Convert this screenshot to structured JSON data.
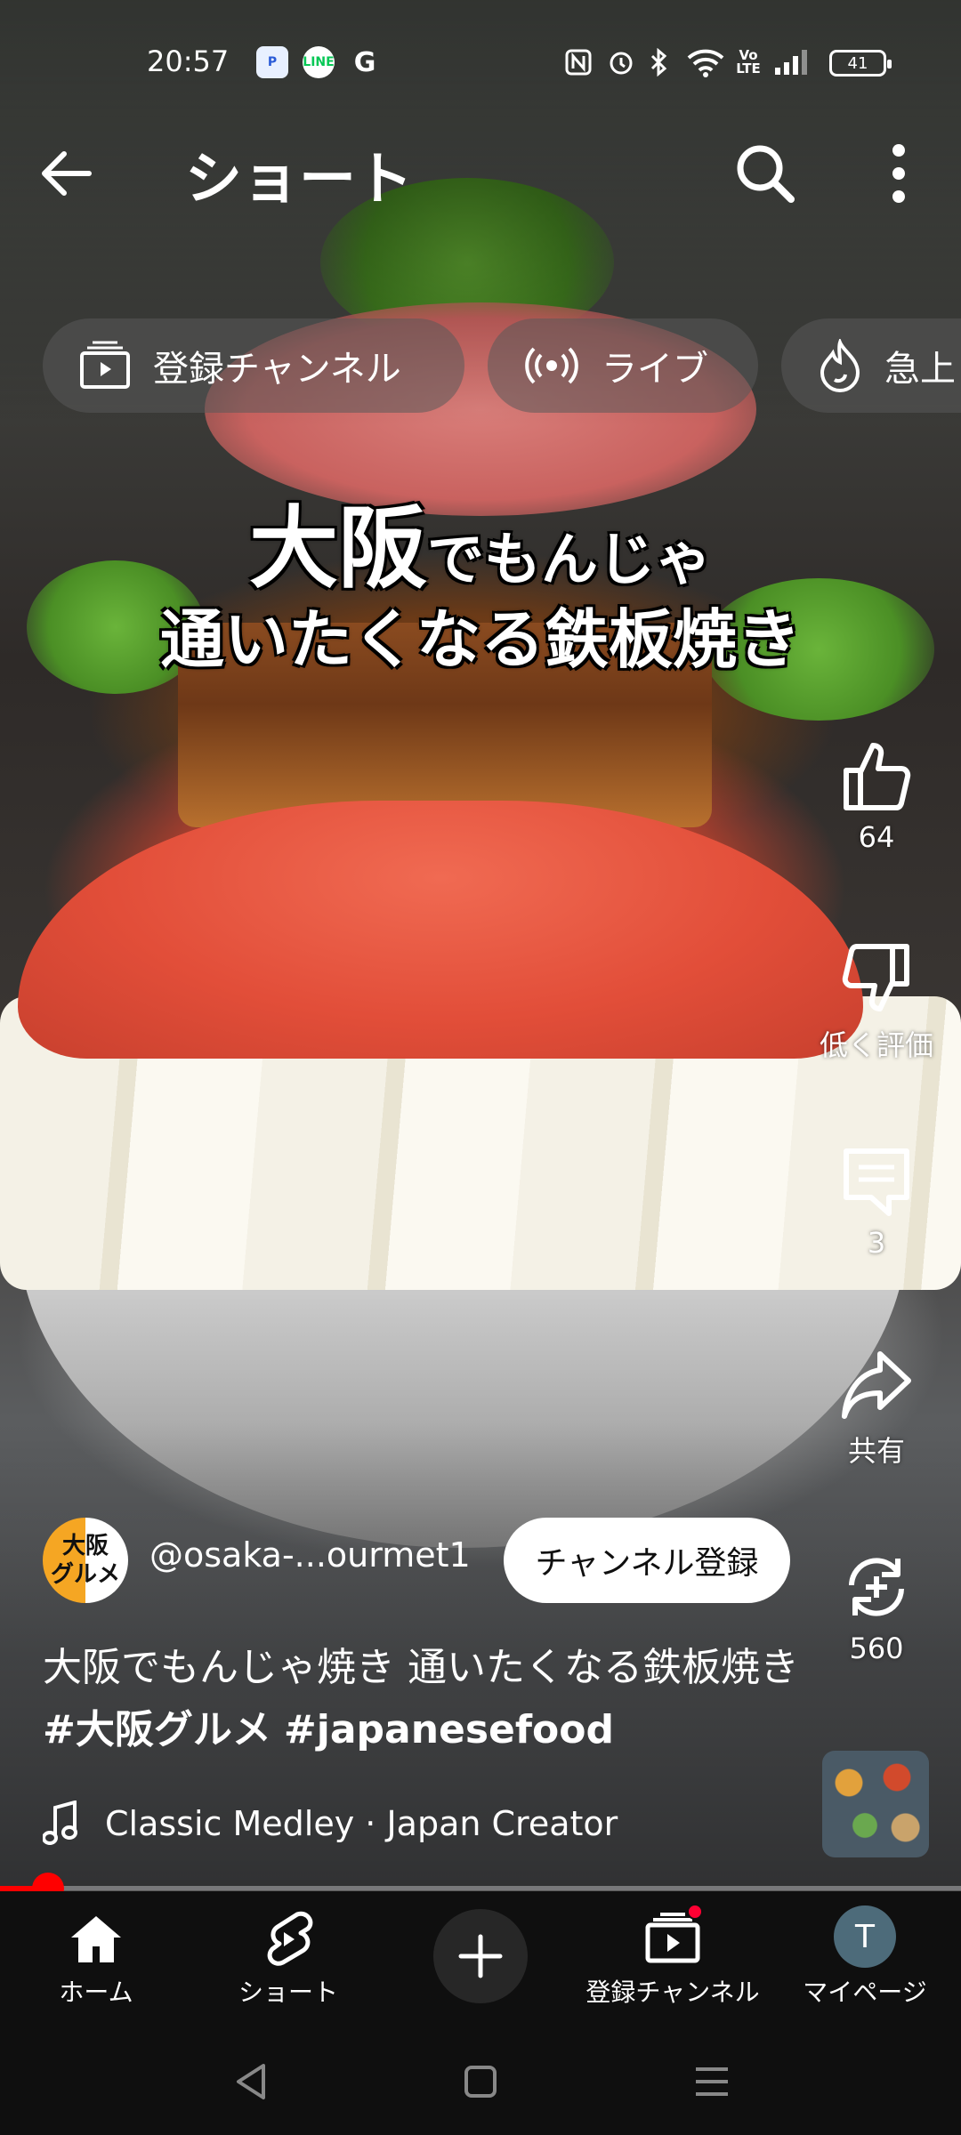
{
  "status_bar": {
    "time": "20:57",
    "notif_icons": [
      "paypay-app-icon",
      "line-icon",
      "google-icon"
    ],
    "line_label": "LINE",
    "google_label": "G",
    "battery": "41"
  },
  "header": {
    "title": "ショート"
  },
  "chips": [
    {
      "label": "登録チャンネル",
      "icon": "subscriptions-icon"
    },
    {
      "label": "ライブ",
      "icon": "live-icon"
    },
    {
      "label": "急上",
      "icon": "trending-icon"
    }
  ],
  "video_caption": {
    "line1_big": "大阪",
    "line1_rest": "でもんじゃ",
    "line2": "通いたくなる鉄板焼き"
  },
  "actions": {
    "like_count": "64",
    "dislike_label": "低く評価",
    "comment_count": "3",
    "share_label": "共有",
    "remix_count": "560"
  },
  "channel": {
    "avatar_line1": "大阪",
    "avatar_line2": "グルメ",
    "handle": "@osaka-...ourmet1",
    "subscribe_label": "チャンネル登録"
  },
  "description": {
    "text": "大阪でもんじゃ焼き 通いたくなる鉄板焼き",
    "tag1": "#大阪グルメ",
    "tag2": "#japanesefood"
  },
  "music": {
    "label": "Classic Medley · Japan Creator"
  },
  "progress": {
    "fraction": 0.05
  },
  "bottom_nav": {
    "home": "ホーム",
    "shorts": "ショート",
    "subscriptions": "登録チャンネル",
    "me": "マイページ",
    "me_initial": "T"
  },
  "colors": {
    "accent_red": "#ff0000",
    "nav_bg": "#0f0f0f"
  }
}
